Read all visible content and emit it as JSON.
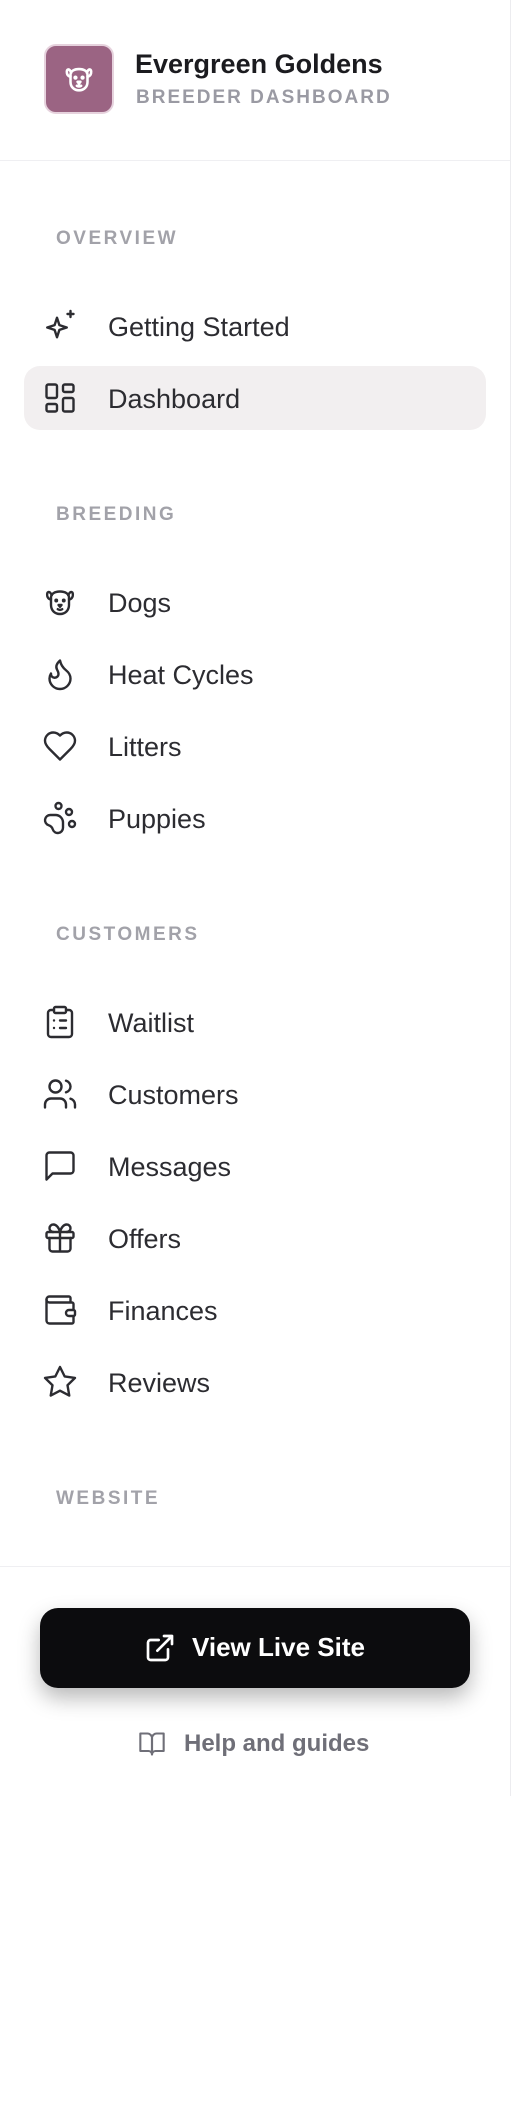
{
  "brand": {
    "name": "Evergreen Goldens",
    "subtitle": "BREEDER DASHBOARD",
    "logo_icon": "dog-face-icon",
    "logo_color": "#9b6483"
  },
  "sections": {
    "overview": "OVERVIEW",
    "breeding": "BREEDING",
    "customers": "CUSTOMERS",
    "website": "WEBSITE"
  },
  "nav": {
    "getting_started": {
      "label": "Getting Started",
      "icon": "sparkles-icon"
    },
    "dashboard": {
      "label": "Dashboard",
      "icon": "layout-dashboard-icon",
      "active": true
    },
    "dogs": {
      "label": "Dogs",
      "icon": "dog-icon"
    },
    "heat_cycles": {
      "label": "Heat Cycles",
      "icon": "flame-icon"
    },
    "litters": {
      "label": "Litters",
      "icon": "heart-icon"
    },
    "puppies": {
      "label": "Puppies",
      "icon": "paw-print-icon"
    },
    "waitlist": {
      "label": "Waitlist",
      "icon": "clipboard-list-icon"
    },
    "customers": {
      "label": "Customers",
      "icon": "users-icon"
    },
    "messages": {
      "label": "Messages",
      "icon": "message-square-icon"
    },
    "offers": {
      "label": "Offers",
      "icon": "gift-icon"
    },
    "finances": {
      "label": "Finances",
      "icon": "wallet-icon"
    },
    "reviews": {
      "label": "Reviews",
      "icon": "star-icon"
    }
  },
  "footer": {
    "view_live_site": "View Live Site",
    "help": "Help and guides"
  }
}
